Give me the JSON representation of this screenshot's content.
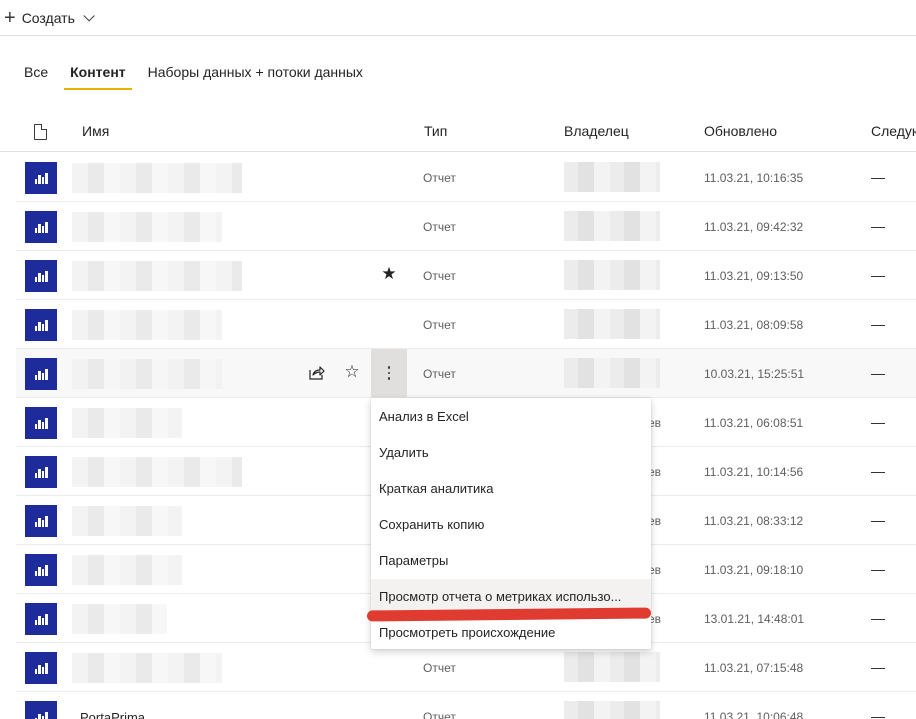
{
  "toolbar": {
    "create_label": "Создать"
  },
  "tabs": [
    "Все",
    "Контент",
    "Наборы данных + потоки данных"
  ],
  "columns": {
    "name": "Имя",
    "type": "Тип",
    "owner": "Владелец",
    "updated": "Обновлено",
    "next": "Следую"
  },
  "rows": [
    {
      "type": "Отчет",
      "updated": "11.03.21, 10:16:35",
      "next": "—"
    },
    {
      "type": "Отчет",
      "updated": "11.03.21, 09:42:32",
      "next": "—"
    },
    {
      "type": "Отчет",
      "updated": "11.03.21, 09:13:50",
      "next": "—"
    },
    {
      "type": "Отчет",
      "updated": "11.03.21, 08:09:58",
      "next": "—"
    },
    {
      "type": "Отчет",
      "updated": "10.03.21, 15:25:51",
      "next": "—"
    },
    {
      "owner_tail": "ев",
      "updated": "11.03.21, 06:08:51",
      "next": "—"
    },
    {
      "owner_tail": "ев",
      "updated": "11.03.21, 10:14:56",
      "next": "—"
    },
    {
      "owner_tail": "ев",
      "updated": "11.03.21, 08:33:12",
      "next": "—"
    },
    {
      "owner_tail": "ев",
      "updated": "11.03.21, 09:18:10",
      "next": "—"
    },
    {
      "owner_tail": "ев",
      "updated": "13.01.21, 14:48:01",
      "next": "—"
    },
    {
      "type": "Отчет",
      "updated": "11.03.21, 07:15:48",
      "next": "—"
    },
    {
      "name": "PortaPrima",
      "type": "Отчет",
      "updated": "11.03.21, 10:06:48",
      "next": "—"
    }
  ],
  "context_menu": [
    "Анализ в Excel",
    "Удалить",
    "Краткая аналитика",
    "Сохранить копию",
    "Параметры",
    "Просмотр отчета о метриках использо...",
    "Просмотреть происхождение"
  ],
  "icons": {
    "create": "plus-icon",
    "dropdown": "chevron-down-icon",
    "file_column": "file-icon",
    "report": "report-icon",
    "share": "share-icon",
    "favorite": "star-icon",
    "more": "more-options-icon"
  },
  "colors": {
    "report_icon": "#1e2b9a",
    "active_tab_underline": "#e8b300",
    "annotation": "#e03b30"
  }
}
